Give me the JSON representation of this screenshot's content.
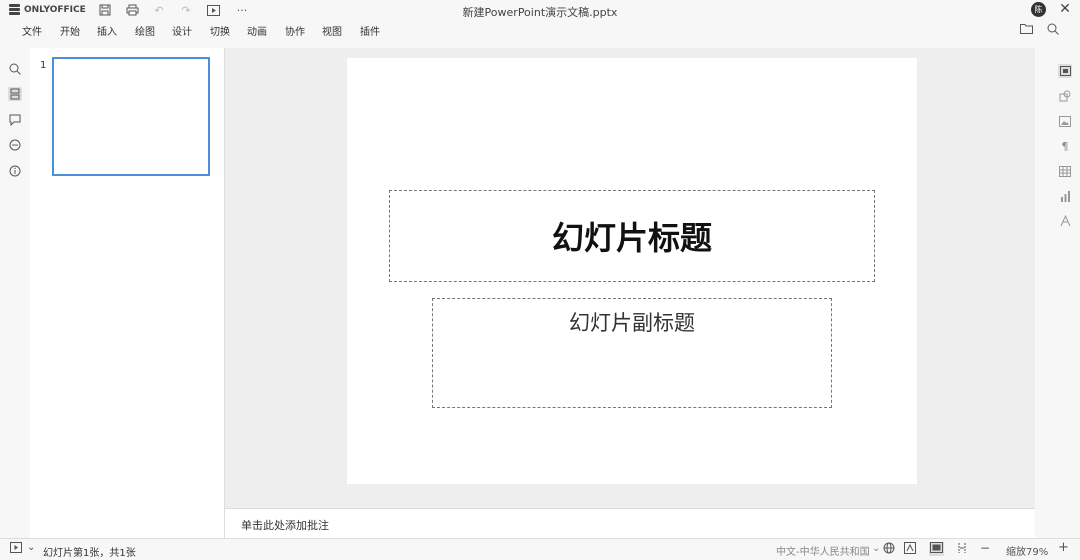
{
  "app": {
    "logo_text": "ONLYOFFICE"
  },
  "window": {
    "title": "新建PowerPoint演示文稿.pptx",
    "close_label": "✕"
  },
  "user": {
    "avatar_initial": "陈"
  },
  "quick_access": {
    "more_label": "···"
  },
  "menu": {
    "items": [
      {
        "label": "文件"
      },
      {
        "label": "开始"
      },
      {
        "label": "插入"
      },
      {
        "label": "绘图"
      },
      {
        "label": "设计"
      },
      {
        "label": "切换"
      },
      {
        "label": "动画"
      },
      {
        "label": "协作"
      },
      {
        "label": "视图"
      },
      {
        "label": "插件"
      }
    ]
  },
  "slide_panel": {
    "slides": [
      {
        "number": "1"
      }
    ]
  },
  "slide": {
    "title_text": "幻灯片标题",
    "subtitle_text": "幻灯片副标题"
  },
  "notes": {
    "placeholder": "单击此处添加批注"
  },
  "status": {
    "slide_info": "幻灯片第1张，共1张",
    "language": "中文-中华人民共和国",
    "zoom": "缩放79%",
    "zoom_in_label": "+",
    "zoom_out_label": "−"
  },
  "colors": {
    "accent": "#4a90d9",
    "background": "#f7f7f7",
    "canvas": "#eeeeee"
  },
  "icons": [
    "logo-icon",
    "save-icon",
    "print-icon",
    "undo-icon",
    "redo-icon",
    "slideshow-icon",
    "more-icon",
    "open-file-location-icon",
    "search-icon",
    "thumbnails-icon",
    "comments-icon",
    "chat-icon",
    "info-icon",
    "slide-settings-icon",
    "shape-settings-icon",
    "image-settings-icon",
    "paragraph-settings-icon",
    "table-settings-icon",
    "chart-settings-icon",
    "text-art-icon",
    "globe-icon",
    "spellcheck-icon",
    "normal-view-icon",
    "fit-width-icon"
  ]
}
